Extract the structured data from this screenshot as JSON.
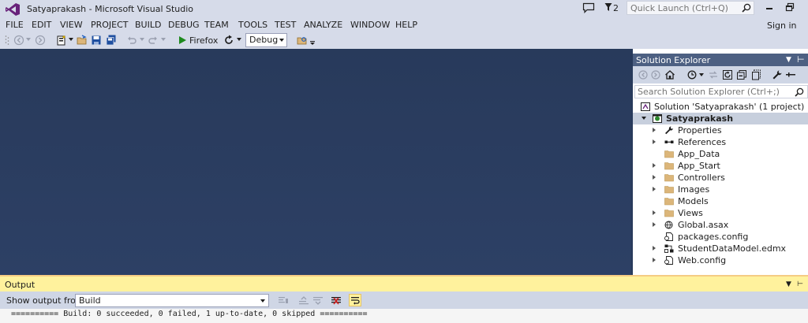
{
  "window": {
    "title": "Satyaprakash - Microsoft Visual Studio",
    "feedback_count": "2",
    "quick_launch_placeholder": "Quick Launch (Ctrl+Q)",
    "sign_in": "Sign in"
  },
  "menu": [
    "FILE",
    "EDIT",
    "VIEW",
    "PROJECT",
    "BUILD",
    "DEBUG",
    "TEAM",
    "TOOLS",
    "TEST",
    "ANALYZE",
    "WINDOW",
    "HELP"
  ],
  "toolbar": {
    "run_target": "Firefox",
    "configuration": "Debug"
  },
  "solution_explorer": {
    "title": "Solution Explorer",
    "search_placeholder": "Search Solution Explorer (Ctrl+;)",
    "tree": [
      {
        "label": "Solution 'Satyaprakash' (1 project)",
        "icon": "solution-icon"
      },
      {
        "label": "Satyaprakash",
        "icon": "web-project-icon",
        "selected": true
      },
      {
        "label": "Properties",
        "icon": "wrench-icon"
      },
      {
        "label": "References",
        "icon": "references-icon"
      },
      {
        "label": "App_Data",
        "icon": "folder-icon"
      },
      {
        "label": "App_Start",
        "icon": "folder-icon"
      },
      {
        "label": "Controllers",
        "icon": "folder-icon"
      },
      {
        "label": "Images",
        "icon": "folder-icon"
      },
      {
        "label": "Models",
        "icon": "folder-icon"
      },
      {
        "label": "Views",
        "icon": "folder-icon"
      },
      {
        "label": "Global.asax",
        "icon": "global-asax-icon"
      },
      {
        "label": "packages.config",
        "icon": "config-file-icon"
      },
      {
        "label": "StudentDataModel.edmx",
        "icon": "edmx-icon"
      },
      {
        "label": "Web.config",
        "icon": "config-file-icon"
      }
    ]
  },
  "output": {
    "title": "Output",
    "show_from_label": "Show output from:",
    "source": "Build",
    "text": "========== Build: 0 succeeded, 0 failed, 1 up-to-date, 0 skipped =========="
  },
  "colors": {
    "chrome": "#d6dbe9",
    "editor_background": "#2d4065",
    "panel_header": "#4d6082",
    "output_header": "#fff29d",
    "selected_row": "#c7cfdd",
    "run_green": "#1e8a1e",
    "vs_purple": "#68217a",
    "folder_yellow": "#dcb67a"
  }
}
